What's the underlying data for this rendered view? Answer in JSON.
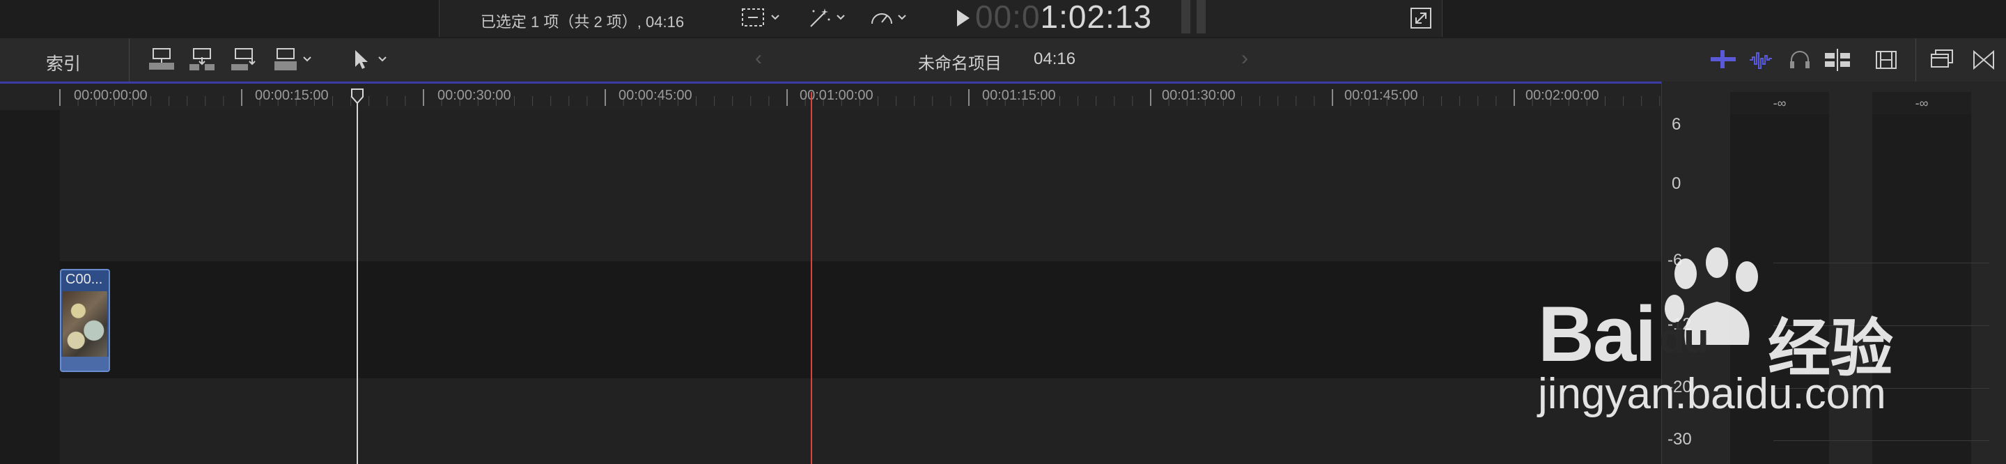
{
  "viewer": {
    "selection_info": "已选定 1 项（共 2 项）, 04:16",
    "timecode_dim": "00:0",
    "timecode_lit": "1:02:13"
  },
  "toolbar": {
    "index_label": "索引",
    "project_name": "未命名项目",
    "project_duration": "04:16"
  },
  "ruler": {
    "labels": [
      "00:00:00:00",
      "00:00:15:00",
      "00:00:30:00",
      "00:00:45:00",
      "00:01:00:00",
      "00:01:15:00",
      "00:01:30:00",
      "00:01:45:00",
      "00:02:00:00"
    ]
  },
  "clip": {
    "name": "C00..."
  },
  "meter": {
    "left_peak": "-∞",
    "right_peak": "-∞",
    "scale": [
      "6",
      "0",
      "-6",
      "-12",
      "-20",
      "-30"
    ]
  },
  "watermark": {
    "brand": "Bai",
    "brand2": "du",
    "cn": "经验",
    "url": "jingyan.baidu.com"
  },
  "colors": {
    "playhead": "#d8d8d8",
    "skimmer": "#d9443c",
    "clip": "#2e4c86",
    "accent_line": "#3b3ca8"
  }
}
